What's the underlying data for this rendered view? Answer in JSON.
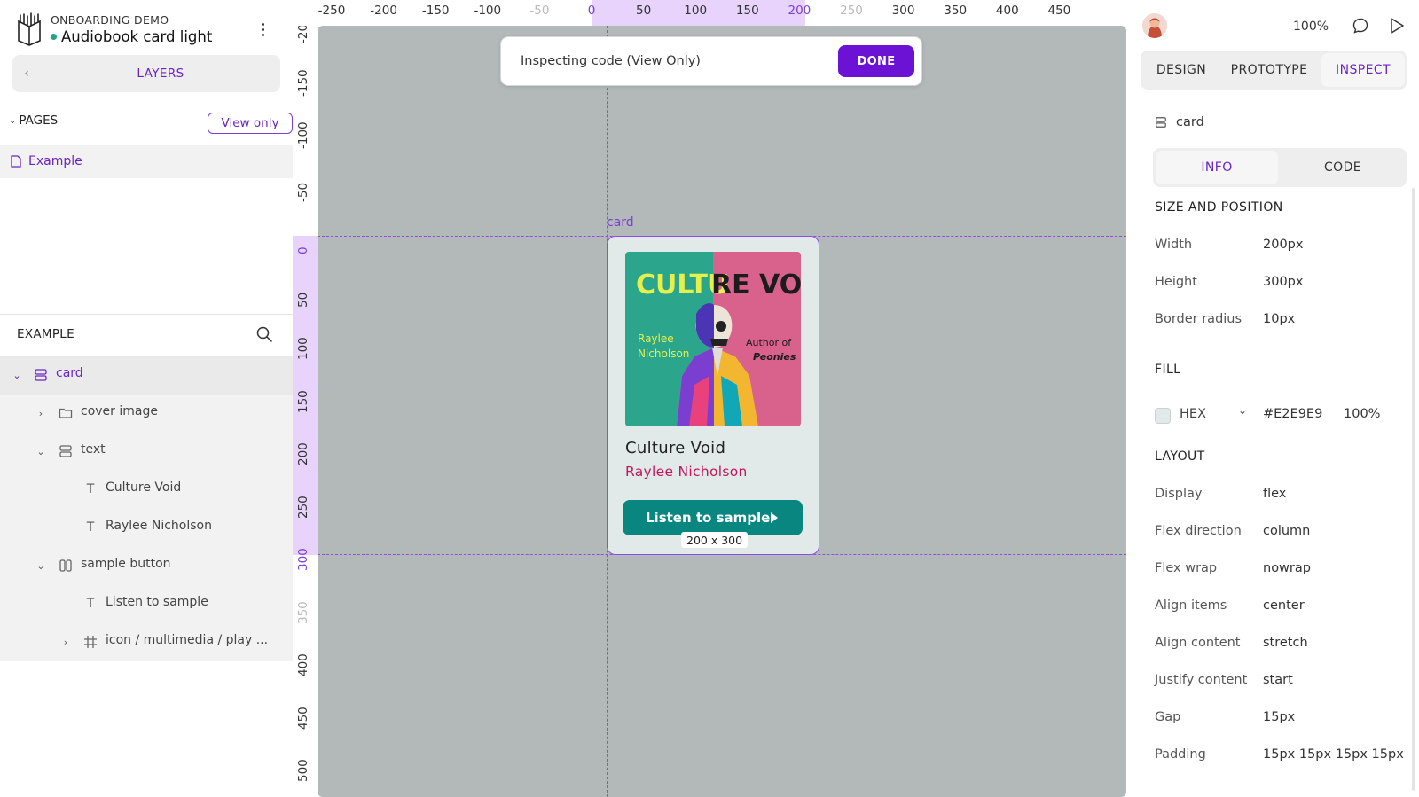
{
  "project": {
    "subtitle": "ONBOARDING DEMO",
    "title": "Audiobook card light"
  },
  "left": {
    "layers_label": "LAYERS",
    "pages_label": "PAGES",
    "view_only": "View only",
    "page_name": "Example",
    "section_label": "EXAMPLE",
    "tree": [
      {
        "label": "card"
      },
      {
        "label": "cover image"
      },
      {
        "label": "text"
      },
      {
        "label": "Culture Void"
      },
      {
        "label": "Raylee Nicholson"
      },
      {
        "label": "sample button"
      },
      {
        "label": "Listen to sample"
      },
      {
        "label": "icon / multimedia / play ..."
      }
    ]
  },
  "rulers": {
    "h_labels": [
      "-250",
      "-200",
      "-150",
      "-100",
      "-50",
      "0",
      "50",
      "100",
      "150",
      "200",
      "250",
      "300",
      "350",
      "400",
      "450"
    ],
    "v_labels": [
      "-200",
      "-150",
      "-100",
      "-50",
      "0",
      "50",
      "100",
      "150",
      "200",
      "250",
      "300",
      "350",
      "400",
      "450",
      "500"
    ]
  },
  "canvas": {
    "banner_text": "Inspecting code (View Only)",
    "done_label": "DONE",
    "card_tag": "card",
    "card": {
      "cover_title_a": "CULTU",
      "cover_title_b": "RE VOID",
      "cover_author_a": "Raylee",
      "cover_author_b": "Nicholson",
      "cover_note_a": "Author of",
      "cover_note_b": "Peonies",
      "title": "Culture Void",
      "author": "Raylee Nicholson",
      "button_label": "Listen to sample"
    },
    "size_tag": "200 x 300"
  },
  "right": {
    "zoom": "100%",
    "tabs": [
      "DESIGN",
      "PROTOTYPE",
      "INSPECT"
    ],
    "active_tab": "INSPECT",
    "layer_name": "card",
    "sub_tabs": [
      "INFO",
      "CODE"
    ],
    "active_sub_tab": "INFO",
    "size_section": "SIZE AND POSITION",
    "size_props": [
      {
        "k": "Width",
        "v": "200px"
      },
      {
        "k": "Height",
        "v": "300px"
      },
      {
        "k": "Border radius",
        "v": "10px"
      }
    ],
    "fill_section": "FILL",
    "fill": {
      "mode": "HEX",
      "hex": "#E2E9E9",
      "opacity": "100%"
    },
    "layout_section": "LAYOUT",
    "layout_props": [
      {
        "k": "Display",
        "v": "flex"
      },
      {
        "k": "Flex direction",
        "v": "column"
      },
      {
        "k": "Flex wrap",
        "v": "nowrap"
      },
      {
        "k": "Align items",
        "v": "center"
      },
      {
        "k": "Align content",
        "v": "stretch"
      },
      {
        "k": "Justify content",
        "v": "start"
      },
      {
        "k": "Gap",
        "v": "15px"
      },
      {
        "k": "Padding",
        "v": "15px 15px 15px 15px"
      }
    ]
  },
  "colors": {
    "accent": "#6b24c6",
    "done_button": "#6b12d4",
    "canvas_bg": "#b3b9b9",
    "card_fill": "#E2E9E9",
    "sample_button": "#0a8680",
    "author_text": "#c0175b"
  },
  "icons": [
    "project-icon",
    "kebab-menu-icon",
    "back-arrow-icon",
    "chevron-down-icon",
    "page-icon",
    "search-icon",
    "board-icon",
    "folder-icon",
    "text-icon",
    "column-layout-icon",
    "frame-icon",
    "chevron-right-icon",
    "comment-icon",
    "play-icon"
  ]
}
